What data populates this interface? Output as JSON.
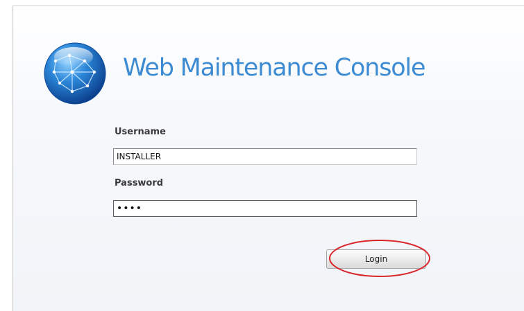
{
  "header": {
    "title": "Web Maintenance Console",
    "logo_icon": "globe-network-icon"
  },
  "form": {
    "username_label": "Username",
    "username_value": "INSTALLER",
    "password_label": "Password",
    "password_value": "••••",
    "login_label": "Login"
  },
  "annotation": {
    "highlight_color": "#d9252a"
  },
  "colors": {
    "title": "#3d8bd3",
    "globe": "#1f6fc8"
  }
}
